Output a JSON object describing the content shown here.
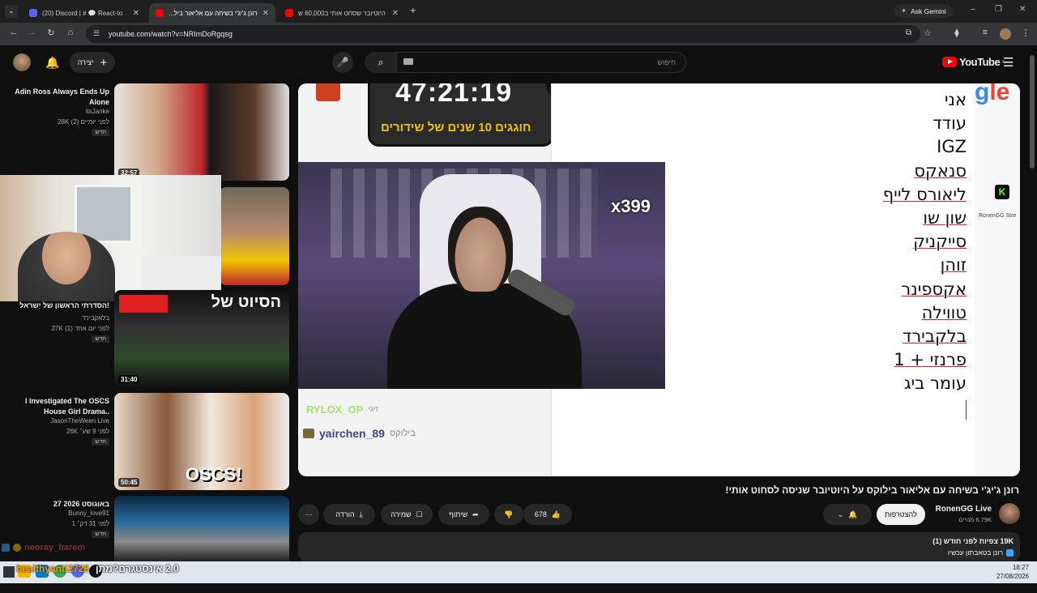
{
  "browser": {
    "tabs": [
      {
        "label": "(20) Discord | # 💬 React-to",
        "active": false,
        "color": "#5865f2"
      },
      {
        "label": "רונן ג'יג'י בשיחה עם אליאור ביל...",
        "active": true,
        "color": "#ff0000"
      },
      {
        "label": "היוטיובר שסחט אותי ב60,000 ש",
        "active": false,
        "color": "#ff0000"
      }
    ],
    "new_tab": "+",
    "gemini": "Ask Gemini",
    "url": "youtube.com/watch?v=NRImDoRgqsg"
  },
  "header": {
    "create_label": "יצירה",
    "search_placeholder": "חיפוש",
    "logo_text": "YouTube",
    "logo_sup": "IL"
  },
  "sidebar": {
    "items": [
      {
        "title": "Adin Ross Always Ends Up Alone",
        "channel": "itsJanke",
        "meta": "28K  לפני יומיים (2)",
        "badge": "חדש",
        "duration": "32:57"
      },
      {
        "title": "",
        "channel": "",
        "meta": "",
        "badge": "",
        "duration": ""
      },
      {
        "title": "הסדרתי הראשון של ישראל!",
        "channel": "בלאקבירד",
        "meta": "27K  לפני יום אחד (1)",
        "badge": "חדש",
        "duration": "31:40",
        "overlay": "הסיוט של"
      },
      {
        "title": "I Investigated The OSCS House Girl Drama..",
        "channel": "JasonTheWeen Live",
        "meta": "26K  לפני 9 שע׳",
        "badge": "חדש",
        "duration": "50:45",
        "overlay": "OSCS!"
      },
      {
        "title": "27 באוגוסט 2026",
        "channel": "Bunny_love91",
        "meta": "1  לפני 31 דק׳",
        "badge": "חדש",
        "duration": ""
      }
    ]
  },
  "player": {
    "timer": "47:21:19",
    "banner": "חוגגים 10 שנים של שידורים",
    "combo": "x399",
    "chat": [
      {
        "user": "RYLOX_OP",
        "suffix": "זיגי"
      },
      {
        "user": "yairchen_89",
        "suffix": "בילוקס"
      }
    ],
    "sidebar_label": "RonenGG Stre",
    "names": [
      {
        "text": "אני",
        "underline": false
      },
      {
        "text": "עודד",
        "underline": false
      },
      {
        "text": "IGZ",
        "underline": false
      },
      {
        "text": "סנאקס",
        "underline": true
      },
      {
        "text": "ליאורס לייף",
        "underline": true
      },
      {
        "text": "שון שו",
        "underline": true
      },
      {
        "text": "סייקניק",
        "underline": true
      },
      {
        "text": "זוהן",
        "underline": true
      },
      {
        "text": "אקספינר",
        "underline": true
      },
      {
        "text": "טווילה",
        "underline": true
      },
      {
        "text": "בלקבירד",
        "underline": true
      },
      {
        "text": "פרנזי + 1",
        "underline": true
      },
      {
        "text": "עומר ביג",
        "underline": false
      }
    ]
  },
  "video": {
    "title": "רונן ג'יג'י בשיחה עם אליאור בילוקס על היוטיובר שניסה לסחוט אותי!",
    "channel": "RonenGG Live",
    "subs": "6.79K מנויים",
    "subscribe": "להצטרפות",
    "likes": "678",
    "share": "שיתוף",
    "save": "שמירה",
    "download": "הורדה",
    "views": "19K צפיות  לפני חודש (1)",
    "desc_line": "רונן בטאבתון עכשיו"
  },
  "overlay_chat": {
    "line1": "neoray_barem",
    "line2_user": "healthyanti2726",
    "line2_text": "2.0 אינסטגרם?מתן"
  },
  "taskbar": {
    "time": "18:27",
    "date": "27/08/2026"
  }
}
